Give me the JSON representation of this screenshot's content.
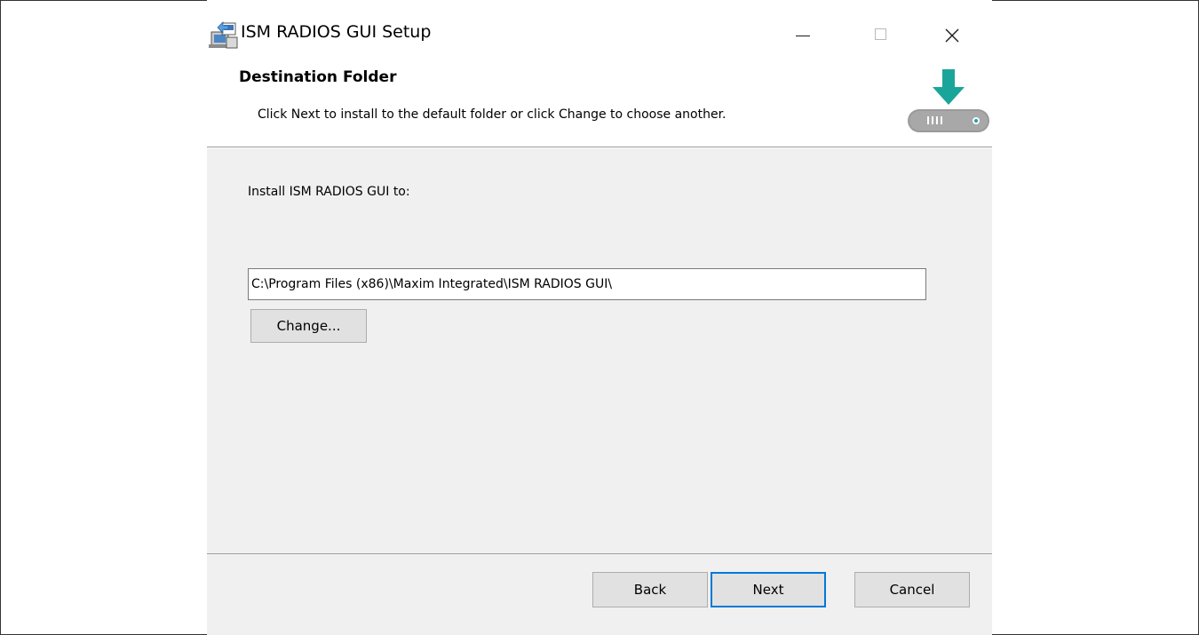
{
  "window": {
    "title": "ISM RADIOS GUI Setup",
    "controls": {
      "minimize": "minimize-icon",
      "maximize": "maximize-icon",
      "close": "close-icon"
    }
  },
  "header": {
    "heading": "Destination Folder",
    "description": "Click Next to install to the default folder or click Change to choose another.",
    "icon": "disk-download-icon",
    "icon_color": "#1aa59a"
  },
  "body": {
    "install_label": "Install ISM RADIOS GUI to:",
    "path_value": "C:\\Program Files (x86)\\Maxim Integrated\\ISM RADIOS GUI\\",
    "change_label": "Change..."
  },
  "footer": {
    "back_label": "Back",
    "next_label": "Next",
    "cancel_label": "Cancel"
  },
  "colors": {
    "dialog_background": "#f0f0f0",
    "default_button_border": "#0078d7"
  }
}
